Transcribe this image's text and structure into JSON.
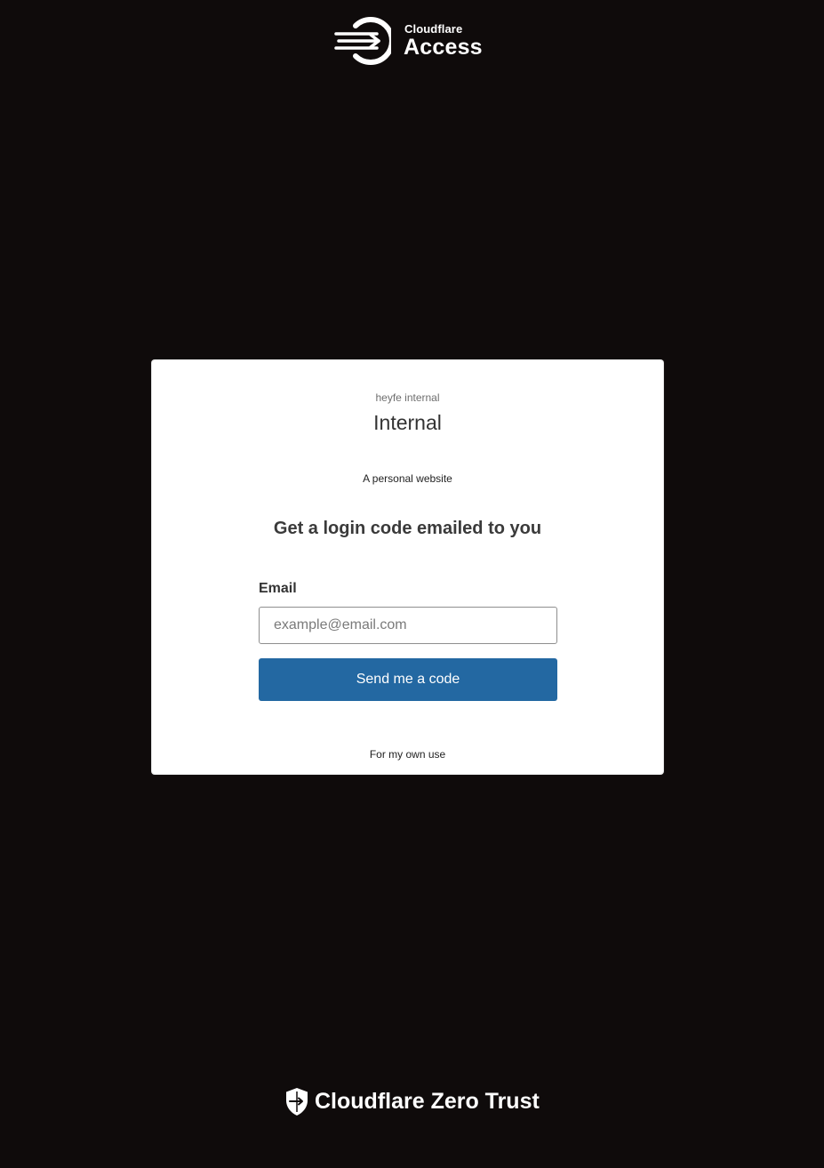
{
  "header": {
    "brand": "Cloudflare",
    "product": "Access",
    "logo_icon": "cloudflare-access-logo-icon"
  },
  "card": {
    "org_name": "heyfe internal",
    "app_name": "Internal",
    "app_description": "A personal website",
    "form_heading": "Get a login code emailed to you",
    "email_label": "Email",
    "email_placeholder": "example@email.com",
    "email_value": "",
    "submit_label": "Send me a code",
    "footer_text": "For my own use"
  },
  "footer": {
    "brand_text": "Cloudflare Zero Trust",
    "logo_icon": "cloudflare-shield-icon"
  },
  "colors": {
    "background": "#0f0b0b",
    "card": "#ffffff",
    "button": "#2368a2",
    "button_text": "#ffffff"
  }
}
